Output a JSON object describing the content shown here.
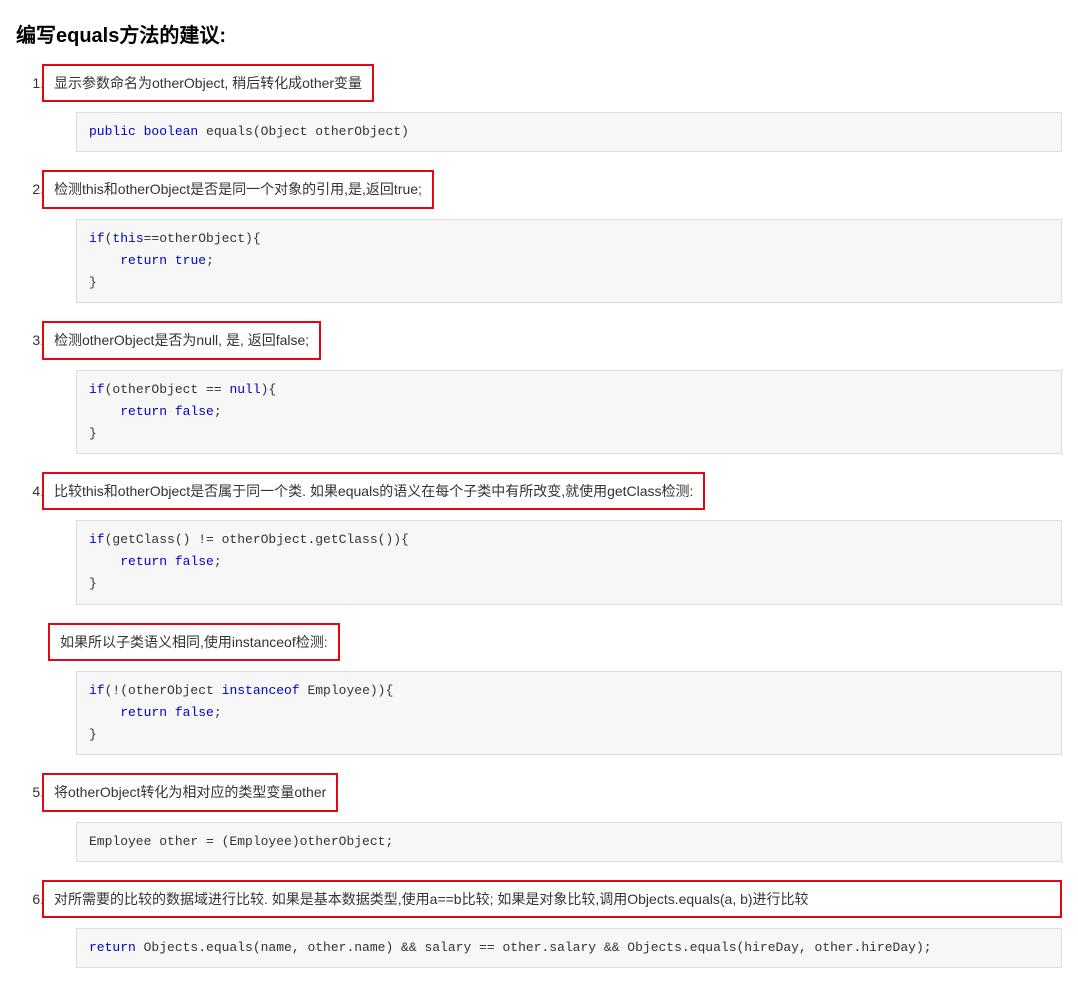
{
  "heading": "编写equals方法的建议:",
  "steps": [
    {
      "text": "显示参数命名为otherObject, 稍后转化成other变量",
      "code_html": "<span class=\"kw\">public</span> <span class=\"kw\">boolean</span> equals(Object otherObject)"
    },
    {
      "text": "检测this和otherObject是否是同一个对象的引用,是,返回true;",
      "code_html": "<span class=\"kw\">if</span>(<span class=\"kw\">this</span>==otherObject){\n    <span class=\"kw\">return</span> <span class=\"kw\">true</span>;\n}"
    },
    {
      "text": "检测otherObject是否为null, 是, 返回false;",
      "code_html": "<span class=\"kw\">if</span>(otherObject == <span class=\"kw\">null</span>){\n    <span class=\"kw\">return</span> <span class=\"kw\">false</span>;\n}"
    },
    {
      "text": "比较this和otherObject是否属于同一个类. 如果equals的语义在每个子类中有所改变,就使用getClass检测:",
      "code_html": "<span class=\"kw\">if</span>(getClass() != otherObject.getClass()){\n    <span class=\"kw\">return</span> <span class=\"kw\">false</span>;\n}",
      "note": "如果所以子类语义相同,使用instanceof检测:",
      "note_code_html": "<span class=\"kw\">if</span>(!(otherObject <span class=\"kw\">instanceof</span> Employee)){\n    <span class=\"kw\">return</span> <span class=\"kw\">false</span>;\n}"
    },
    {
      "text": "将otherObject转化为相对应的类型变量other",
      "code_html": "Employee other = (Employee)otherObject;"
    },
    {
      "text": "对所需要的比较的数据域进行比较. 如果是基本数据类型,使用a==b比较; 如果是对象比较,调用Objects.equals(a, b)进行比较",
      "code_html": "<span class=\"kw\">return</span> Objects.equals(name, other.name) && salary == other.salary && Objects.equals(hireDay, other.hireDay);"
    }
  ]
}
